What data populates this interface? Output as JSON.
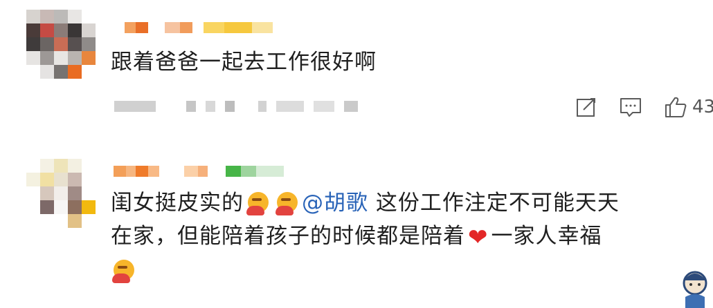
{
  "comments": [
    {
      "text": "跟着爸爸一起去工作很好啊",
      "likes": "43",
      "icons": [
        "edit-icon",
        "comment-icon",
        "thumbs-up-icon"
      ]
    },
    {
      "text_prefix": "闺女挺皮实的",
      "mention": "@胡歌",
      "text_line1_suffix": "这份工作注定不可能天天",
      "text_line2": "在家，但能陪着孩子的时候都是陪着",
      "text_line2_suffix": "一家人幸福",
      "emojis": [
        "bow-emoji",
        "bow-emoji",
        "red-heart-emoji",
        "bow-emoji"
      ]
    }
  ],
  "colors": {
    "text": "#1f1f1f",
    "mention": "#2a64b8",
    "heart": "#e32727",
    "icon": "#5a5a5a"
  }
}
